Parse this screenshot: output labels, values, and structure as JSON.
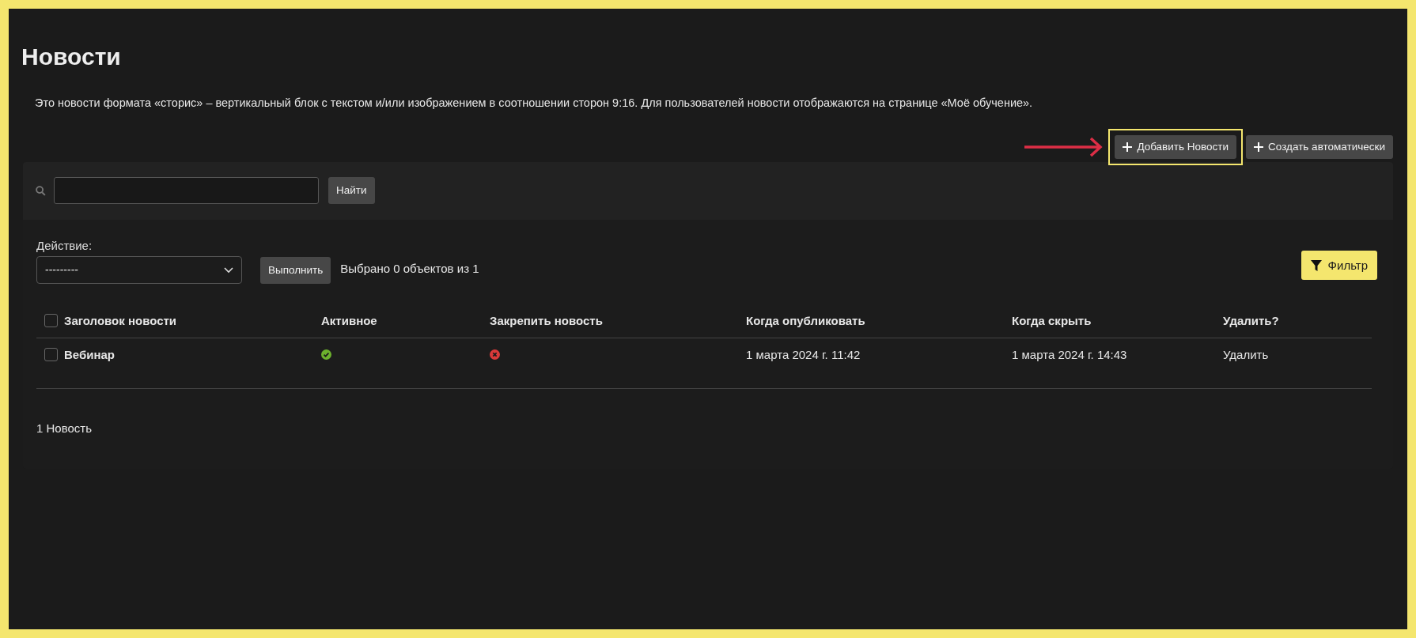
{
  "page": {
    "title": "Новости",
    "description": "Это новости формата «сторис» – вертикальный блок с текстом и/или изображением в соотношении сторон 9:16. Для пользователей новости отображаются на странице «Моё обучение»."
  },
  "toolbar_buttons": [
    {
      "label": "Добавить Новости",
      "highlighted": true
    },
    {
      "label": "Создать автоматически",
      "highlighted": false
    }
  ],
  "search": {
    "button": "Найти"
  },
  "actions": {
    "label": "Действие:",
    "select_value": "---------",
    "run_button": "Выполнить",
    "selection_count": "Выбрано 0 объектов из 1",
    "filter_button": "Фильтр"
  },
  "table": {
    "header_checked": false,
    "columns": [
      "Заголовок новости",
      "Активное",
      "Закрепить новость",
      "Когда опубликовать",
      "Когда скрыть",
      "Удалить?"
    ],
    "rows": [
      {
        "checked": false,
        "title": "Вебинар",
        "active": true,
        "pinned": false,
        "publish": "1 марта 2024 г. 11:42",
        "hide": "1 марта 2024 г. 14:43",
        "delete": "Удалить"
      }
    ]
  },
  "footer": {
    "count": "1 Новость"
  }
}
